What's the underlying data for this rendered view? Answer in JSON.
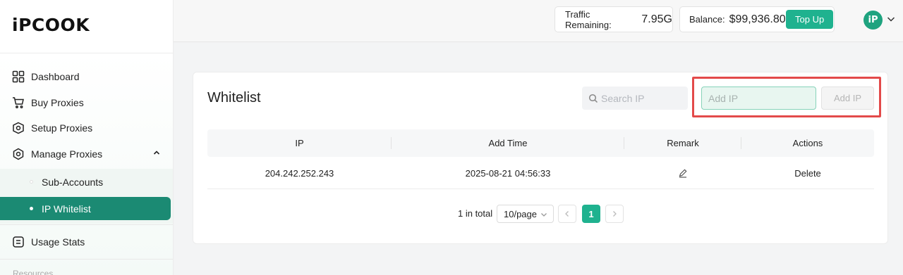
{
  "brand": {
    "logo_text": "iPCOOK"
  },
  "sidebar": {
    "items": [
      {
        "label": "Dashboard",
        "icon": "grid-icon"
      },
      {
        "label": "Buy Proxies",
        "icon": "cart-icon"
      },
      {
        "label": "Setup Proxies",
        "icon": "box-icon"
      },
      {
        "label": "Manage Proxies",
        "icon": "gear-icon"
      },
      {
        "label": "Usage Stats",
        "icon": "list-icon"
      }
    ],
    "sub_items": [
      {
        "label": "Sub-Accounts"
      },
      {
        "label": "IP Whitelist",
        "active": true
      }
    ],
    "resources_label": "Resources"
  },
  "header": {
    "traffic_label": "Traffic Remaining:",
    "traffic_value": "7.95G",
    "balance_label": "Balance:",
    "balance_value": "$99,936.80",
    "topup_label": "Top Up",
    "avatar_initials": "iP"
  },
  "whitelist": {
    "title": "Whitelist",
    "search_placeholder": "Search IP",
    "add_ip_placeholder": "Add IP",
    "add_ip_button": "Add IP",
    "columns": [
      "IP",
      "Add Time",
      "Remark",
      "Actions"
    ],
    "rows": [
      {
        "ip": "204.242.252.243",
        "add_time": "2025-08-21 04:56:33",
        "remark_icon": "edit-icon",
        "action": "Delete"
      }
    ],
    "pagination": {
      "total_text": "1 in total",
      "page_size": "10/page",
      "current_page": "1"
    }
  },
  "colors": {
    "accent": "#1fb28f",
    "active_nav": "#1b8a73",
    "highlight_box": "#e34a4a"
  }
}
